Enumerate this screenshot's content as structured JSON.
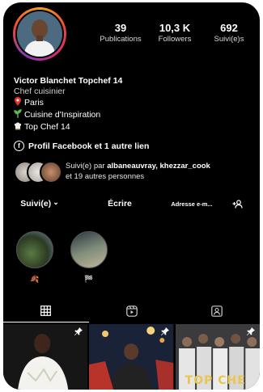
{
  "stats": [
    {
      "value": "39",
      "label": "Publications"
    },
    {
      "value": "10,3 K",
      "label": "Followers"
    },
    {
      "value": "692",
      "label": "Suivi(e)s"
    }
  ],
  "bio": {
    "name": "Victor Blanchet Topchef 14",
    "category": "Chef cuisinier",
    "lines": [
      {
        "icon": "pin-icon",
        "text": "Paris"
      },
      {
        "icon": "plant-icon",
        "text": "Cuisine d'Inspiration"
      },
      {
        "icon": "chef-hat-icon",
        "text": "Top Chef 14"
      }
    ]
  },
  "links": {
    "label": "Profil Facebook et 1 autre lien"
  },
  "followed_by": {
    "prefix": "Suivi(e) par",
    "users": "albaneauvray, khezzar_cook",
    "suffix": "et 19 autres personnes"
  },
  "actions": {
    "follow": "Suivi(e)",
    "chevron": "⌄",
    "message": "Écrire",
    "email": "Adresse e-m..."
  },
  "highlights": [
    {
      "label": "🍂"
    },
    {
      "label": "🏁"
    }
  ],
  "colors": {
    "background": "#000000",
    "text": "#ffffff",
    "accent": "#e9c64d"
  },
  "posts": [
    {
      "pinned": true,
      "overlay": ""
    },
    {
      "pinned": true,
      "overlay": ""
    },
    {
      "pinned": true,
      "overlay": "TOP CHE"
    }
  ]
}
